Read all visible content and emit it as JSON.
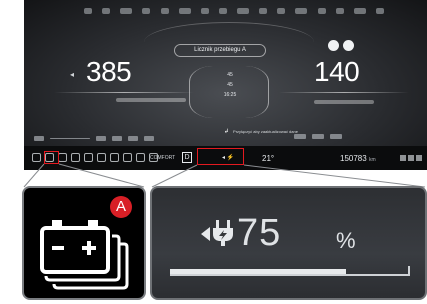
{
  "cluster": {
    "trip_label": "Licznik przebiegu A",
    "left_value": "385",
    "right_value": "140",
    "center_rows": [
      "45",
      "45",
      "16:25"
    ],
    "message": "Przyłączyć aby zaaktualizować dane",
    "bar": {
      "comfort_label": "COMFORT",
      "drive_mode": "D",
      "temperature": "21°",
      "odometer": "150783",
      "odometer_unit": "km"
    }
  },
  "zoom": {
    "badge": "A",
    "battery_icon": "battery-pack-icon",
    "charge_icon": "charging-plug-icon",
    "charge_value": "75",
    "charge_unit": "%",
    "charge_level": 0.75
  },
  "colors": {
    "highlight": "#e41a20",
    "badge": "#d81f26"
  }
}
